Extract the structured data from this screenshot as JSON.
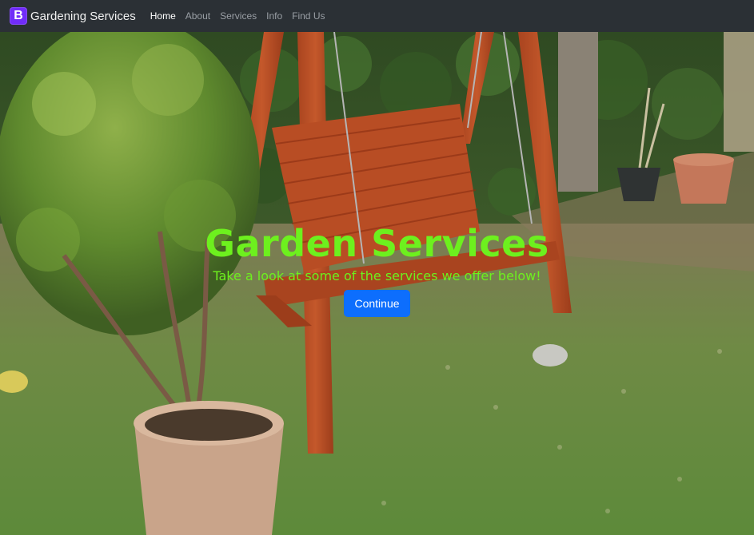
{
  "navbar": {
    "brand_letter": "B",
    "brand_name": "Gardening Services",
    "links": [
      {
        "label": "Home",
        "active": true
      },
      {
        "label": "About",
        "active": false
      },
      {
        "label": "Services",
        "active": false
      },
      {
        "label": "Info",
        "active": false
      },
      {
        "label": "Find Us",
        "active": false
      }
    ]
  },
  "hero": {
    "title": "Garden Services",
    "subtitle": "Take a look at some of the services we offer below!",
    "button_label": "Continue"
  },
  "colors": {
    "navbar_bg": "#2b3035",
    "brand_logo": "#712cf9",
    "hero_text": "#6df01e",
    "button_bg": "#0d6efd"
  }
}
